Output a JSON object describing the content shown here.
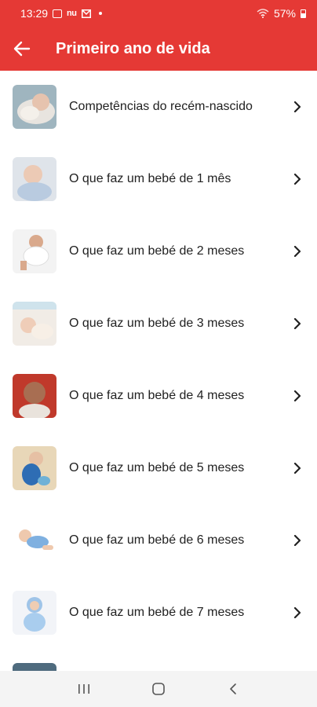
{
  "status_bar": {
    "time": "13:29",
    "icons": [
      "image-icon",
      "nu-icon",
      "mail-icon",
      "dot-icon"
    ],
    "nu_text": "nu",
    "battery": "57%"
  },
  "app_bar": {
    "title": "Primeiro ano de vida",
    "back_icon": "arrow-left-icon",
    "color": "#e53935"
  },
  "items": [
    {
      "label": "Competências do recém-nascido"
    },
    {
      "label": "O que faz um bebé de 1 mês"
    },
    {
      "label": "O que faz um bebé de 2 meses"
    },
    {
      "label": "O que faz um bebé de 3 meses"
    },
    {
      "label": "O que faz um bebé de 4 meses"
    },
    {
      "label": "O que faz um bebé de 5 meses"
    },
    {
      "label": "O que faz um bebé de 6 meses"
    },
    {
      "label": "O que faz um bebé de 7 meses"
    }
  ],
  "nav_bar": {
    "icons": [
      "recent-apps-icon",
      "home-icon",
      "back-icon"
    ]
  }
}
